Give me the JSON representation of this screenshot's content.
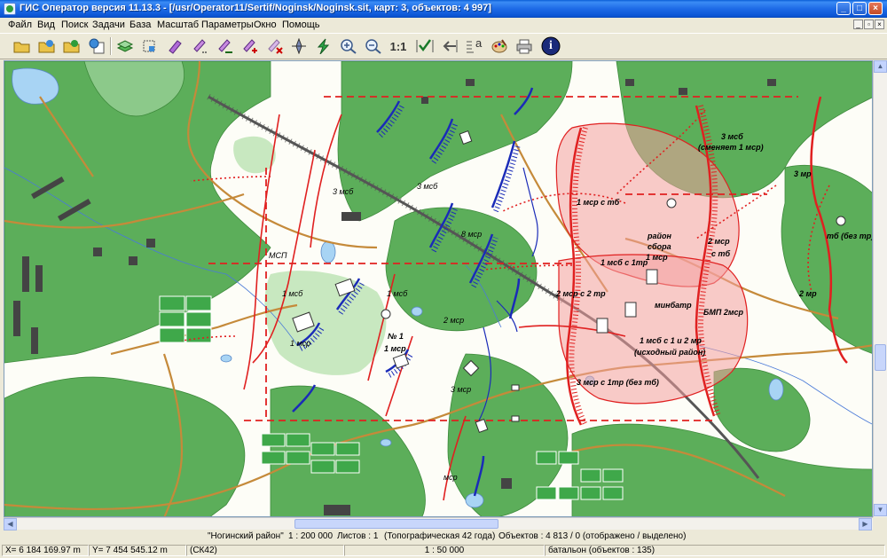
{
  "window": {
    "title": "ГИС Оператор версия 11.13.3 - [/usr/Operator11/Sertif/Noginsk/Noginsk.sit, карт: 3, объектов: 4 997]",
    "min_glyph": "_",
    "max_glyph": "□",
    "close_glyph": "×"
  },
  "menu": {
    "items": [
      "Файл",
      "Вид",
      "Поиск",
      "Задачи",
      "База",
      "Масштаб",
      "Параметры",
      "Окно",
      "Помощь"
    ],
    "mdi": [
      "_",
      "▫",
      "×"
    ]
  },
  "toolbar": {
    "scale_label": "1:1",
    "text_tool": "a",
    "info_glyph": "i"
  },
  "map": {
    "labels": [
      "3 мсб",
      "3 мсб",
      "8 мср",
      "МСП",
      "1 мсб",
      "1 мсб",
      "2 мср",
      "1 мср",
      "№ 1",
      "1 мср",
      "3 мср",
      "мср",
      "3 мсб",
      "(сменяет 1 мср)",
      "1 мср с тб",
      "район",
      "сбора",
      "1 мср",
      "2 мср",
      "с тб",
      "1 мсб с 1тр",
      "2 мср с 2 тр",
      "минбатр",
      "БМП 2мср",
      "1 мсб с 1 и 2 мр",
      "(исходный район)",
      "3 мср с 1тр (без тб)",
      "3 мр",
      "тб (без тр)",
      "2 мр"
    ]
  },
  "status": {
    "region": "\"Ногинский район\"",
    "scale": "1 : 200 000",
    "sheets": "Листов : 1",
    "topo": "(Топографическая 42 года)",
    "objects": "Объектов : 4 813 / 0 (отображено / выделено)",
    "x": "X= 6 184 169.97 m",
    "y": "Y= 7 454 545.12 m",
    "cs": "(СК42)",
    "cur_scale": "1 : 50 000",
    "layer": "батальон  (объектов : 135)"
  },
  "colors": {
    "forest": "#5cae5a",
    "field": "#fdfdf7",
    "road": "#d4a15a",
    "red": "#e02020",
    "blue": "#1a2bb8",
    "zone": "#f4a0a0"
  }
}
